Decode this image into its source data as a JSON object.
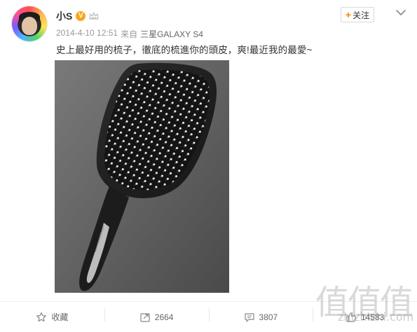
{
  "post": {
    "author": {
      "name": "小S",
      "verified_badge": "V",
      "avatar_icon": "avatar-photo",
      "member_icon": "crown-icon"
    },
    "timestamp": "2014-4-10 12:51",
    "source_prefix": "来自",
    "source_device": "三星GALAXY S4",
    "follow_label": "关注",
    "follow_plus": "+",
    "text": "史上最好用的梳子，徹底的梳進你的頭皮，爽!最近我的最愛~",
    "image_description_icon": "hairbrush-photo"
  },
  "actions": {
    "favorite": {
      "label": "收藏",
      "icon": "star-icon"
    },
    "repost": {
      "count": "2664",
      "icon": "repost-icon"
    },
    "comment": {
      "count": "3807",
      "icon": "comment-icon"
    },
    "like": {
      "count": "14583",
      "icon": "thumbs-up-icon"
    }
  },
  "watermark": {
    "chars": "值值值",
    "url": "zhizhizhi.com"
  },
  "colors": {
    "accent_orange": "#ff8200",
    "badge": "#f6a623",
    "text_muted": "#999999"
  }
}
